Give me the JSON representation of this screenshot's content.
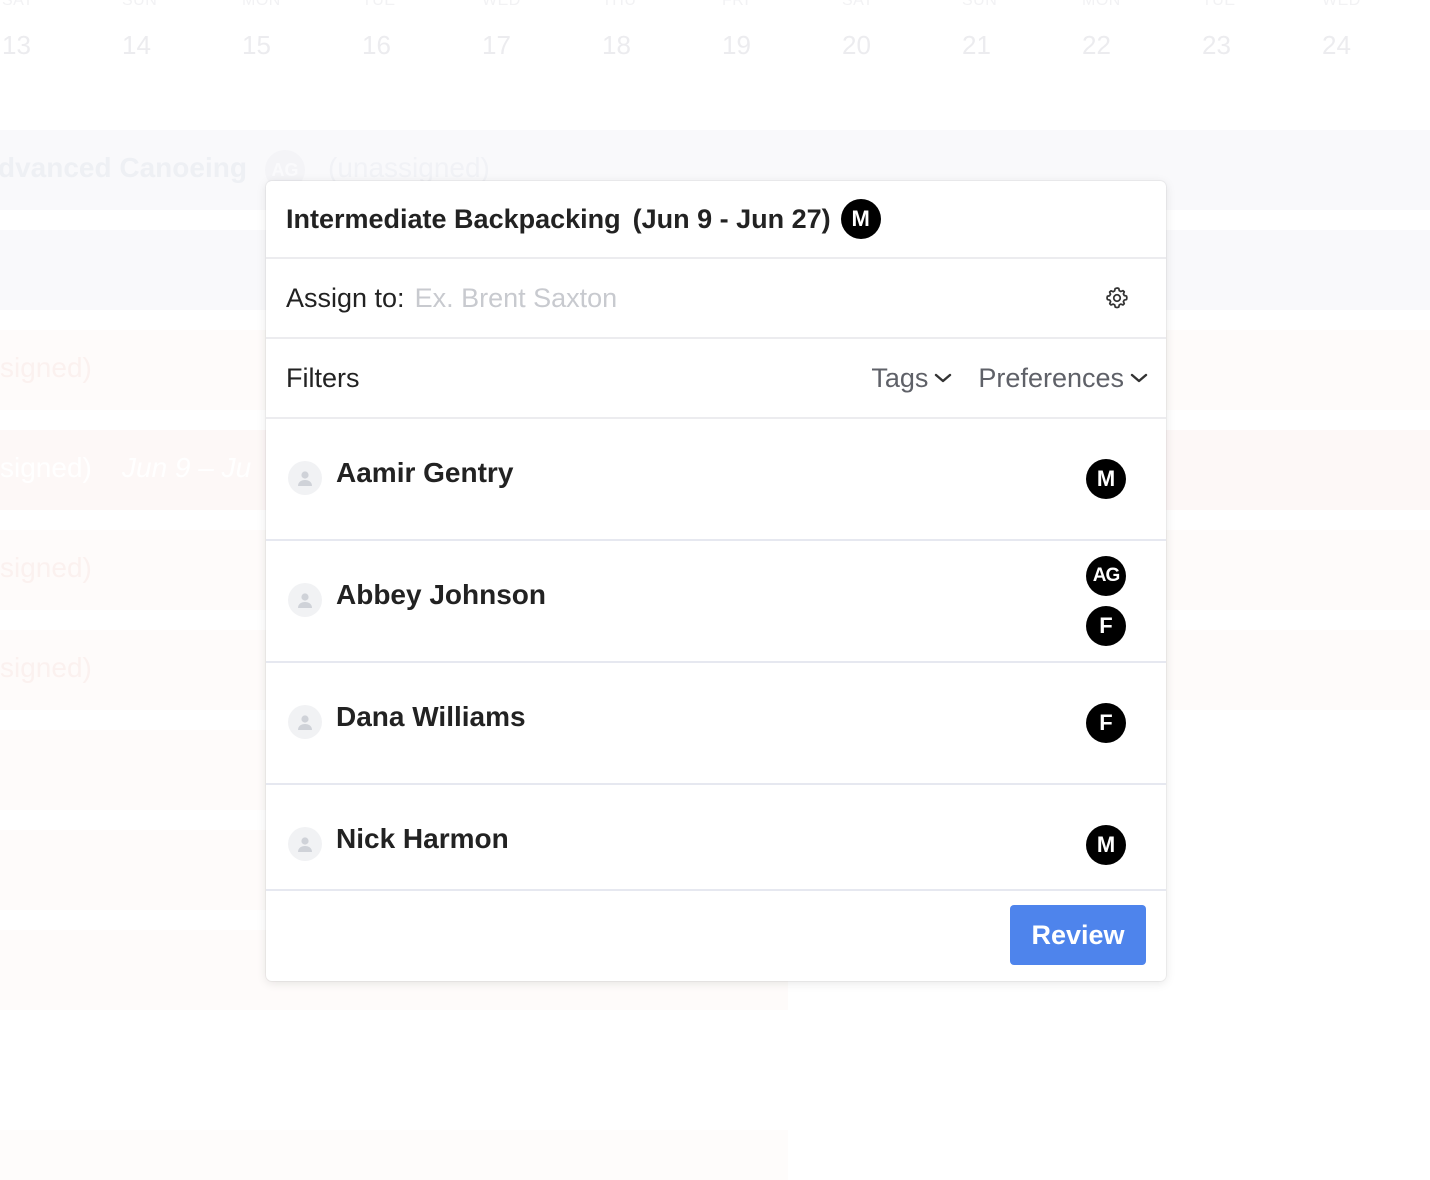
{
  "calendar": {
    "day_names": [
      "SAT",
      "SUN",
      "MON",
      "TUE",
      "WED",
      "THU",
      "FRI",
      "SAT",
      "SUN",
      "MON",
      "TUE",
      "WED"
    ],
    "day_numbers": [
      "13",
      "14",
      "15",
      "16",
      "17",
      "18",
      "19",
      "20",
      "21",
      "22",
      "23",
      "24"
    ],
    "rows": [
      {
        "text": "dvanced Canoeing",
        "avatar": "AG",
        "status": "(unassigned)"
      },
      {
        "text": "signed)"
      },
      {
        "text": "signed)",
        "dates": "Jun 9 – Ju"
      },
      {
        "text": "signed)"
      },
      {
        "text": "signed)"
      }
    ]
  },
  "popover": {
    "title": "Intermediate Backpacking",
    "dates": "(Jun 9 - Jun 27)",
    "title_badge": "M",
    "assign_label": "Assign to:",
    "assign_placeholder": "Ex. Brent Saxton",
    "filters_label": "Filters",
    "tags_label": "Tags",
    "preferences_label": "Preferences",
    "people": [
      {
        "name": "Aamir Gentry",
        "badges": [
          "M"
        ]
      },
      {
        "name": "Abbey Johnson",
        "badges": [
          "AG",
          "F"
        ]
      },
      {
        "name": "Dana Williams",
        "badges": [
          "F"
        ]
      },
      {
        "name": "Nick Harmon",
        "badges": [
          "M"
        ]
      }
    ],
    "review_label": "Review"
  },
  "colors": {
    "accent": "#4e84ec",
    "badge_bg": "#000000"
  }
}
